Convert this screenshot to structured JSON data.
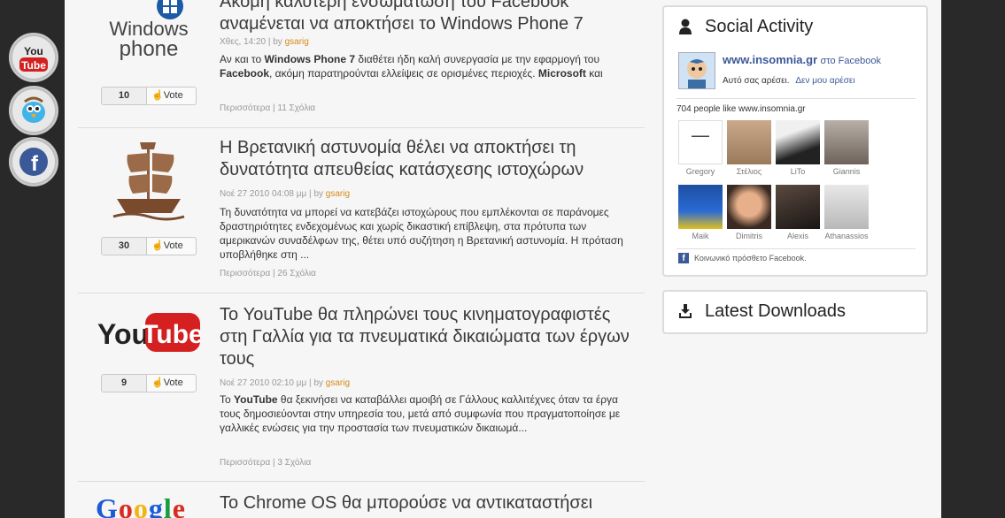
{
  "social_icons": [
    {
      "name": "youtube-social-icon",
      "label": "You Tube"
    },
    {
      "name": "twitter-social-icon",
      "label": ""
    },
    {
      "name": "facebook-social-icon",
      "label": "f"
    }
  ],
  "articles": [
    {
      "title": "Ακόμη καλύτερη ενσωμάτωση του Facebook αναμένεται να αποκτήσει το Windows Phone 7",
      "logo": "windows-phone-logo",
      "logo_text_1": "Windows",
      "logo_text_2": "phone",
      "date": "Χθες, 14:20",
      "by": "by",
      "author": "gsarig",
      "body_parts": [
        "Αν και το ",
        "Windows Phone 7",
        " διαθέτει ήδη καλή συνεργασία με την εφαρμογή του ",
        "Facebook",
        ", ακόμη παρατηρούνται ελλείψεις σε ορισμένες περιοχές. ",
        "Microsoft",
        " και"
      ],
      "votes": "10",
      "vote_label": "Vote",
      "more": "Περισσότερα",
      "comments": "11 Σχόλια"
    },
    {
      "title": "Η Βρετανική αστυνομία θέλει να αποκτήσει τη δυνατότητα απευθείας κατάσχεσης ιστοχώρων",
      "logo": "pirate-ship-logo",
      "date": "Νοέ 27 2010 04:08 μμ",
      "by": "by",
      "author": "gsarig",
      "body": "Τη δυνατότητα να μπορεί να κατεβάζει ιστοχώρους που εμπλέκονται σε παράνομες δραστηριότητες ενδεχομένως και χωρίς δικαστική επίβλεψη, στα πρότυπα των αμερικανών συναδέλφων της, θέτει υπό συζήτηση η Βρετανική αστυνομία. Η πρόταση υποβλήθηκε στη ...",
      "votes": "30",
      "vote_label": "Vote",
      "more": "Περισσότερα",
      "comments": "26 Σχόλια"
    },
    {
      "title": "Το YouTube θα πληρώνει τους κινηματογραφιστές στη Γαλλία για τα πνευματικά δικαιώματα των έργων τους",
      "logo": "youtube-logo",
      "logo_text_1": "You",
      "logo_text_2": "Tube",
      "date": "Νοέ 27 2010 02:10 μμ",
      "by": "by",
      "author": "gsarig",
      "body_parts": [
        "Το ",
        "YouTube",
        " θα ξεκινήσει να καταβάλλει αμοιβή σε Γάλλους καλλιτέχνες όταν τα έργα τους δημοσιεύονται στην υπηρεσία του, μετά από συμφωνία που πραγματοποίησε με γαλλικές ενώσεις για την προστασία των πνευματικών δικαιωμά..."
      ],
      "votes": "9",
      "vote_label": "Vote",
      "more": "Περισσότερα",
      "comments": "3 Σχόλια"
    },
    {
      "title": "Το Chrome OS θα μπορούσε να αντικαταστήσει",
      "logo": "google-logo",
      "logo_text": "Google"
    }
  ],
  "social_widget": {
    "title": "Social Activity",
    "page_link": "www.insomnia.gr",
    "on_fb": "στο Facebook",
    "you_like": "Αυτό σας αρέσει.",
    "unlike": "Δεν μου αρέσει",
    "people_like": "704 people like www.insomnia.gr",
    "friends": [
      "Gregory",
      "Στέλιος",
      "LiTo",
      "Giannis",
      "Maik",
      "Dimitris",
      "Alexis",
      "Athanassios"
    ],
    "plugin_label": "Κοινωνικό πρόσθετο Facebook."
  },
  "downloads_widget": {
    "title": "Latest Downloads"
  },
  "colors": {
    "author": "#d48a1a",
    "link": "#3b5998",
    "background": "#292929"
  }
}
